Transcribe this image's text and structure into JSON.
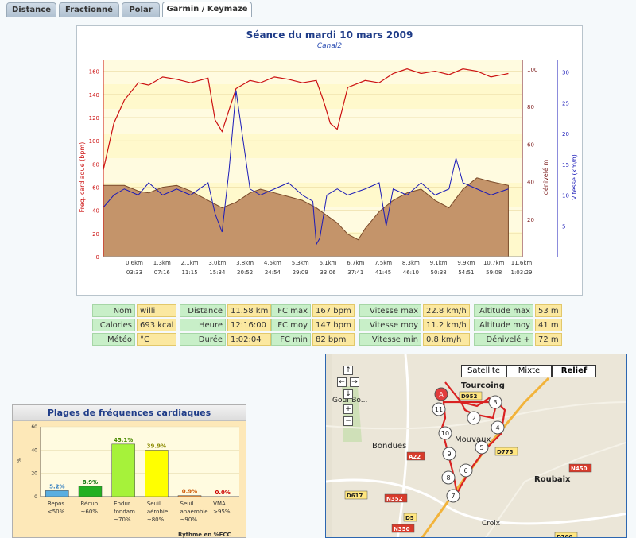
{
  "tabs": [
    "Distance",
    "Fractionné",
    "Polar",
    "Garmin / Keymaze"
  ],
  "chart": {
    "title": "Séance du mardi 10 mars 2009",
    "subtitle": "Canal2",
    "left_axis_label": "Freq. cardiaque (bpm)",
    "mid_axis_label": "dénivelé m",
    "right_axis_label": "Vitesse (km/h)",
    "left_ticks": [
      "0",
      "20",
      "40",
      "60",
      "80",
      "100",
      "120",
      "140",
      "160"
    ],
    "mid_ticks": [
      "20",
      "40",
      "60",
      "80",
      "100"
    ],
    "right_ticks": [
      "5",
      "10",
      "15",
      "20",
      "25",
      "30"
    ],
    "x_distance": [
      "0.6km",
      "1.3km",
      "2.1km",
      "3.0km",
      "3.8km",
      "4.5km",
      "5.3km",
      "6.1km",
      "6.7km",
      "7.5km",
      "8.3km",
      "9.1km",
      "9.9km",
      "10.7km",
      "11.6km"
    ],
    "x_time": [
      "03:33",
      "07:16",
      "11:15",
      "15:34",
      "20:52",
      "24:54",
      "29:09",
      "33:06",
      "37:41",
      "41:45",
      "46:10",
      "50:38",
      "54:51",
      "59:08",
      "1:03:29"
    ]
  },
  "chart_data": {
    "type": "line",
    "x_unit": "km",
    "series": [
      {
        "name": "Freq. cardiaque (bpm)",
        "axis": "left",
        "color": "#cc1111",
        "x": [
          0,
          0.3,
          0.6,
          1.0,
          1.3,
          1.7,
          2.1,
          2.5,
          3.0,
          3.2,
          3.4,
          3.8,
          4.2,
          4.5,
          4.9,
          5.3,
          5.7,
          6.1,
          6.3,
          6.5,
          6.7,
          7.0,
          7.5,
          7.9,
          8.3,
          8.7,
          9.1,
          9.5,
          9.9,
          10.3,
          10.7,
          11.1,
          11.6
        ],
        "y": [
          75,
          115,
          135,
          150,
          148,
          155,
          153,
          150,
          154,
          118,
          108,
          145,
          152,
          150,
          155,
          153,
          150,
          152,
          135,
          115,
          110,
          146,
          152,
          150,
          158,
          162,
          158,
          160,
          157,
          162,
          160,
          155,
          158
        ]
      },
      {
        "name": "Vitesse (km/h)",
        "axis": "right",
        "color": "#1a1ab8",
        "x": [
          0,
          0.3,
          0.6,
          1.0,
          1.3,
          1.7,
          2.1,
          2.5,
          3.0,
          3.2,
          3.4,
          3.6,
          3.8,
          4.2,
          4.5,
          4.9,
          5.3,
          5.7,
          6.0,
          6.1,
          6.2,
          6.4,
          6.7,
          7.0,
          7.5,
          7.9,
          8.1,
          8.3,
          8.7,
          9.1,
          9.5,
          9.9,
          10.1,
          10.3,
          10.7,
          11.1,
          11.6
        ],
        "y": [
          8,
          10,
          11,
          10,
          12,
          10,
          11,
          10,
          12,
          7,
          4,
          14,
          27,
          11,
          10,
          11,
          12,
          10,
          9,
          2,
          3,
          10,
          11,
          10,
          11,
          12,
          5,
          11,
          10,
          12,
          10,
          11,
          16,
          12,
          11,
          10,
          11
        ]
      },
      {
        "name": "dénivelé m",
        "axis": "mid",
        "color": "#7a4a2a",
        "fill": "#c4946a",
        "x": [
          0,
          0.6,
          1.0,
          1.3,
          1.7,
          2.1,
          2.5,
          3.0,
          3.4,
          3.8,
          4.2,
          4.5,
          4.9,
          5.3,
          5.7,
          6.1,
          6.4,
          6.7,
          7.0,
          7.3,
          7.5,
          7.9,
          8.3,
          8.7,
          9.1,
          9.5,
          9.9,
          10.3,
          10.7,
          11.1,
          11.6
        ],
        "y": [
          38,
          38,
          35,
          34,
          37,
          38,
          35,
          30,
          26,
          29,
          34,
          36,
          34,
          32,
          30,
          26,
          22,
          18,
          12,
          9,
          15,
          24,
          30,
          34,
          36,
          30,
          26,
          36,
          42,
          40,
          38
        ]
      }
    ],
    "left_ylim": [
      0,
      170
    ],
    "mid_ylim": [
      0,
      105
    ],
    "right_ylim": [
      0,
      32
    ]
  },
  "stats": {
    "group1": [
      {
        "label": "Nom",
        "value": "willi"
      },
      {
        "label": "Calories",
        "value": "693 kcal"
      },
      {
        "label": "Météo",
        "value": "°C"
      }
    ],
    "group2": [
      {
        "label": "Distance",
        "value": "11.58 km"
      },
      {
        "label": "Heure",
        "value": "12:16:00"
      },
      {
        "label": "Durée",
        "value": "1:02:04"
      }
    ],
    "group3": [
      {
        "label": "FC max",
        "value": "167 bpm"
      },
      {
        "label": "FC moy",
        "value": "147 bpm"
      },
      {
        "label": "FC min",
        "value": "82 bpm"
      }
    ],
    "group4": [
      {
        "label": "Vitesse max",
        "value": "22.8 km/h"
      },
      {
        "label": "Vitesse moy",
        "value": "11.2 km/h"
      },
      {
        "label": "Vitesse min",
        "value": "0.8 km/h"
      }
    ],
    "group5": [
      {
        "label": "Altitude max",
        "value": "53 m"
      },
      {
        "label": "Altitude moy",
        "value": "41 m"
      },
      {
        "label": "Dénivelé +",
        "value": "72 m"
      }
    ]
  },
  "zones": {
    "title": "Plages de fréquences cardiaques",
    "ylabel": "%",
    "yticks": [
      "0",
      "20",
      "40",
      "60"
    ],
    "footer": "Rythme en %FCC",
    "chart_data": {
      "type": "bar",
      "categories": [
        "Repos <50%",
        "Récup. ~60%",
        "Endur. fondam. ~70%",
        "Seuil aérobie ~80%",
        "Seuil anaérobie ~90%",
        "VMA >95%"
      ],
      "values": [
        5.2,
        8.9,
        45.1,
        39.9,
        0.9,
        0.0
      ],
      "ylim": [
        0,
        60
      ]
    },
    "bars": [
      {
        "l1": "Repos",
        "l2": "<50%",
        "l3": "",
        "value": 5.2,
        "label": "5.2%",
        "color": "#5aaee0",
        "label_color": "#2a7ac0"
      },
      {
        "l1": "Récup.",
        "l2": "~60%",
        "l3": "",
        "value": 8.9,
        "label": "8.9%",
        "color": "#22b022",
        "label_color": "#117711"
      },
      {
        "l1": "Endur.",
        "l2": "fondam.",
        "l3": "~70%",
        "value": 45.1,
        "label": "45.1%",
        "color": "#a6f23a",
        "label_color": "#4a8a00"
      },
      {
        "l1": "Seuil",
        "l2": "aérobie",
        "l3": "~80%",
        "value": 39.9,
        "label": "39.9%",
        "color": "#ffff00",
        "label_color": "#8a8a00"
      },
      {
        "l1": "Seuil",
        "l2": "anaérobie",
        "l3": "~90%",
        "value": 0.9,
        "label": "0.9%",
        "color": "#ff9a3a",
        "label_color": "#d06010"
      },
      {
        "l1": "VMA",
        "l2": ">95%",
        "l3": "",
        "value": 0.0,
        "label": "0.0%",
        "color": "#ff2222",
        "label_color": "#cc0000"
      }
    ]
  },
  "map": {
    "buttons": [
      "Satellite",
      "Mixte",
      "Relief"
    ],
    "places": [
      "Tourcoing",
      "Mouvaux",
      "Bondues",
      "Roubaix",
      "Croix",
      "Gouf Bo..."
    ],
    "roads": [
      "D952",
      "D775",
      "A22",
      "N352",
      "D617",
      "D5",
      "N350",
      "N450",
      "D700"
    ],
    "markers": [
      "A",
      "11",
      "2",
      "3",
      "4",
      "5",
      "6",
      "7",
      "8",
      "9",
      "10"
    ],
    "controls": [
      "↑",
      "←",
      "→",
      "↓",
      "+",
      "−"
    ]
  }
}
